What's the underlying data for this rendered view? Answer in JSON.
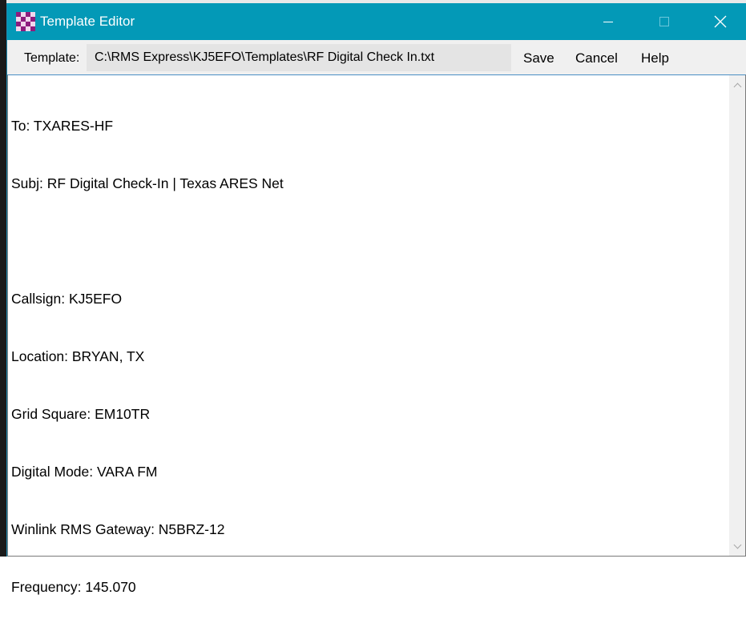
{
  "window": {
    "title": "Template Editor"
  },
  "toolbar": {
    "template_label": "Template:",
    "template_path": "C:\\RMS Express\\KJ5EFO\\Templates\\RF Digital Check In.txt",
    "save_label": "Save",
    "cancel_label": "Cancel",
    "help_label": "Help"
  },
  "editor": {
    "lines": [
      "To: TXARES-HF",
      "Subj: RF Digital Check-In | Texas ARES Net",
      "",
      "Callsign: KJ5EFO",
      "Location: BRYAN, TX",
      "Grid Square: EM10TR",
      "Digital Mode: VARA FM",
      "Winlink RMS Gateway: N5BRZ-12",
      "Frequency: 145.070"
    ]
  },
  "colors": {
    "titlebar": "#0399b7",
    "icon_purple": "#8e1c7e"
  },
  "icons": {
    "app": "checkerboard-icon",
    "minimize": "minimize-icon",
    "maximize": "maximize-icon",
    "close": "close-icon",
    "scroll_up": "chevron-up-icon",
    "scroll_down": "chevron-down-icon"
  }
}
